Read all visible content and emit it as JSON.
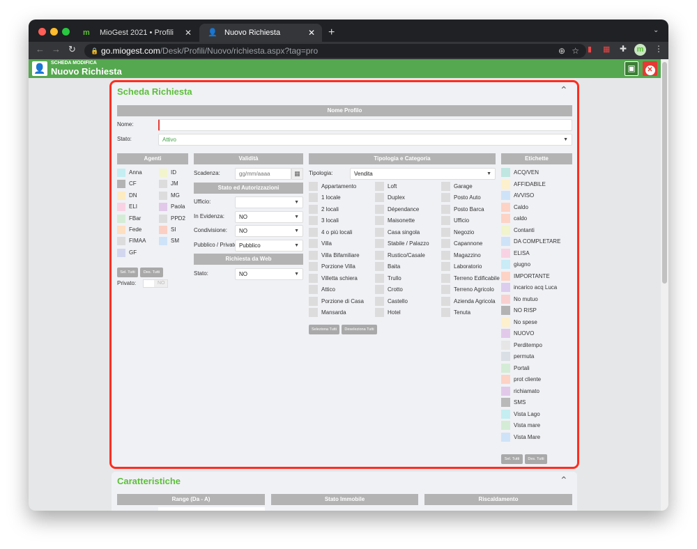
{
  "browser": {
    "tabs": [
      {
        "title": "MioGest 2021 • Profili"
      },
      {
        "title": "Nuovo Richiesta"
      }
    ],
    "url_host": "go.miogest.com",
    "url_path": "/Desk/Profili/Nuovo/richiesta.aspx?tag=pro"
  },
  "header": {
    "subtitle": "SCHEDA MODIFICA",
    "title": "Nuovo Richiesta"
  },
  "scheda": {
    "title": "Scheda Richiesta",
    "nome_profilo": "Nome Profilo",
    "nome_label": "Nome:",
    "nome_value": "",
    "stato_label": "Stato:",
    "stato_value": "Attivo"
  },
  "agenti": {
    "title": "Agenti",
    "items": [
      {
        "name": "Anna",
        "color": "#c4eef2"
      },
      {
        "name": "CF",
        "color": "#b3b3b3"
      },
      {
        "name": "DN",
        "color": "#fdebc2"
      },
      {
        "name": "ELI",
        "color": "#f9d3e3"
      },
      {
        "name": "FBar",
        "color": "#d4ecd6"
      },
      {
        "name": "Fede",
        "color": "#fddfc2"
      },
      {
        "name": "FIMAA",
        "color": "#dcdcdc"
      },
      {
        "name": "GF",
        "color": "#d3d6ef"
      },
      {
        "name": "ID",
        "color": "#f2f4cc"
      },
      {
        "name": "JM",
        "color": "#dcdcdc"
      },
      {
        "name": "MG",
        "color": "#dcdcdc"
      },
      {
        "name": "Paola",
        "color": "#e2c9ea"
      },
      {
        "name": "PPD2",
        "color": "#dcdcdc"
      },
      {
        "name": "SI",
        "color": "#fbcfc4"
      },
      {
        "name": "SM",
        "color": "#cfe3f8"
      }
    ],
    "sel_all": "Sel. Tutti",
    "des_all": "Des. Tutti",
    "privato_label": "Privato:",
    "privato_value": "NO"
  },
  "validita": {
    "title": "Validità",
    "scadenza_label": "Scadenza:",
    "scadenza_placeholder": "gg/mm/aaaa",
    "stato_aut_title": "Stato ed Autorizzazioni",
    "ufficio_label": "Ufficio:",
    "ufficio_value": "",
    "evidenza_label": "In Evidenza:",
    "evidenza_value": "NO",
    "condivisione_label": "Condivisione:",
    "condivisione_value": "NO",
    "pubblico_label": "Pubblico / Privato:",
    "pubblico_value": "Pubblico",
    "web_title": "Richiesta da Web",
    "web_stato_label": "Stato:",
    "web_stato_value": "NO"
  },
  "tipologia": {
    "title": "Tipologia e Categoria",
    "label": "Tipologia:",
    "value": "Vendita",
    "categories": [
      [
        "Appartamento",
        "1 locale",
        "2 locali",
        "3 locali",
        "4 o più locali",
        "Villa",
        "Villa Bifamiliare",
        "Porzione Villa",
        "Villetta schiera",
        "Attico",
        "Porzione di Casa",
        "Mansarda"
      ],
      [
        "Loft",
        "Duplex",
        "Dépendance",
        "Maisonette",
        "Casa singola",
        "Stabile / Palazzo",
        "Rustico/Casale",
        "Baita",
        "Trullo",
        "Crotto",
        "Castello",
        "Hotel"
      ],
      [
        "Garage",
        "Posto Auto",
        "Posto Barca",
        "Ufficio",
        "Negozio",
        "Capannone",
        "Magazzino",
        "Laboratorio",
        "Terreno Edificabile",
        "Terreno Agricolo",
        "Azienda Agricola",
        "Tenuta"
      ]
    ],
    "sel_all": "Seleziona Tutti",
    "des_all": "Deseleziona Tutti"
  },
  "etichette": {
    "title": "Etichette",
    "items": [
      {
        "name": "ACQ/VEN",
        "color": "#bfe6e0"
      },
      {
        "name": "AFFIDABILE",
        "color": "#fcf1cc"
      },
      {
        "name": "AVVISO",
        "color": "#cfe3f8"
      },
      {
        "name": "Caldo",
        "color": "#fdd3c6"
      },
      {
        "name": "caldo",
        "color": "#fdd3c6"
      },
      {
        "name": "Contanti",
        "color": "#f1f4cc"
      },
      {
        "name": "DA COMPLETARE",
        "color": "#cfe3f8"
      },
      {
        "name": "ELISA",
        "color": "#f9d3e3"
      },
      {
        "name": "giugno",
        "color": "#c9ecf7"
      },
      {
        "name": "IMPORTANTE",
        "color": "#fdd3c6"
      },
      {
        "name": "incarico acq Luca",
        "color": "#dccdee"
      },
      {
        "name": "No mutuo",
        "color": "#f9d0d0"
      },
      {
        "name": "NO RISP",
        "color": "#b3b3b3"
      },
      {
        "name": "No spese",
        "color": "#fdf0cc"
      },
      {
        "name": "NUOVO",
        "color": "#e2c9ea"
      },
      {
        "name": "Perditempo",
        "color": "#e6e6e6"
      },
      {
        "name": "permuta",
        "color": "#d9dfe4"
      },
      {
        "name": "Portali",
        "color": "#d4ecd6"
      },
      {
        "name": "prot cliente",
        "color": "#fdd3c6"
      },
      {
        "name": "richiamato",
        "color": "#e2c9ea"
      },
      {
        "name": "SMS",
        "color": "#b9b9b9"
      },
      {
        "name": "Vista Lago",
        "color": "#c4eef2"
      },
      {
        "name": "Vista mare",
        "color": "#d4ecd6"
      },
      {
        "name": "Vista Mare",
        "color": "#cfe3f8"
      }
    ],
    "sel_all": "Sel. Tutti",
    "des_all": "Des. Tutti"
  },
  "caratteristiche": {
    "title": "Caratteristiche",
    "headers": [
      "Range (Da - A)",
      "Stato Immobile",
      "Riscaldamento"
    ]
  }
}
